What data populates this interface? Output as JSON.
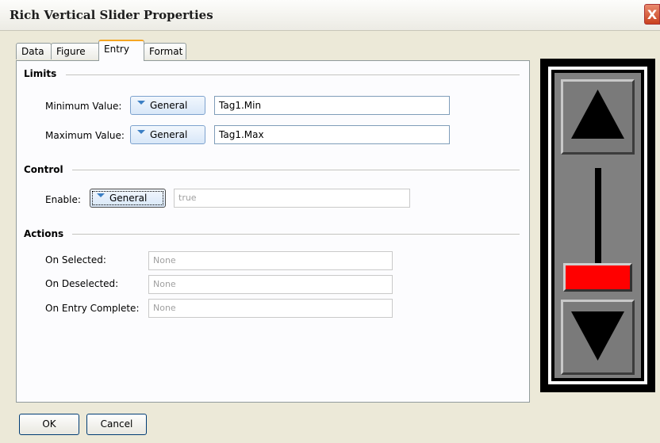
{
  "window": {
    "title": "Rich Vertical Slider Properties",
    "close_label": "X"
  },
  "tabs": [
    {
      "label": "Data"
    },
    {
      "label": "Figure"
    },
    {
      "label": "Entry",
      "active": true
    },
    {
      "label": "Format"
    }
  ],
  "limits": {
    "heading": "Limits",
    "min": {
      "label": "Minimum Value:",
      "mode": "General",
      "value": "Tag1.Min"
    },
    "max": {
      "label": "Maximum Value:",
      "mode": "General",
      "value": "Tag1.Max"
    }
  },
  "control": {
    "heading": "Control",
    "enable": {
      "label": "Enable:",
      "mode": "General",
      "value": "true"
    }
  },
  "actions": {
    "heading": "Actions",
    "on_selected": {
      "label": "On Selected:",
      "value": "None"
    },
    "on_deselected": {
      "label": "On Deselected:",
      "value": "None"
    },
    "on_entry_complete": {
      "label": "On Entry Complete:",
      "value": "None"
    }
  },
  "footer": {
    "ok": "OK",
    "cancel": "Cancel"
  },
  "preview": {
    "thumb_color": "#ff0000",
    "background": "#808080"
  }
}
